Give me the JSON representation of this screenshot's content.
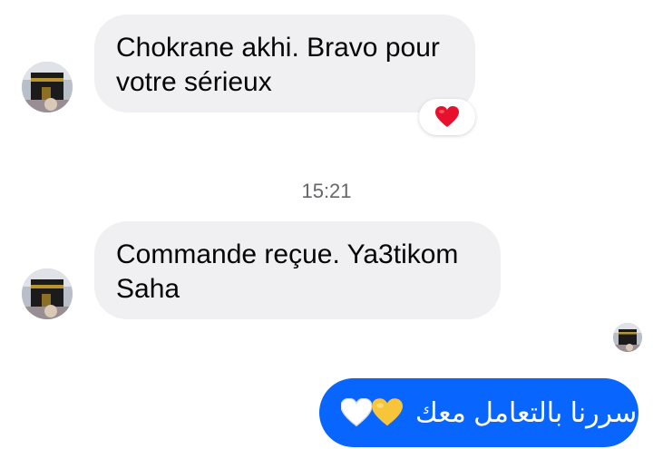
{
  "messages": [
    {
      "lines": [
        "Chokrane akhi. Bravo pour",
        "votre sérieux"
      ],
      "reaction": "red-heart"
    },
    {
      "lines": [
        "Commande reçue. Ya3tikom",
        "Saha"
      ]
    }
  ],
  "timestamp": "15:21",
  "outgoing": {
    "text": "سررنا بالتعامل معك",
    "emojis": [
      "white-heart",
      "yellow-heart"
    ]
  },
  "colors": {
    "incoming_bubble": "#f0f0f3",
    "outgoing_bubble": "#0866ff",
    "timestamp": "#65676b",
    "red_heart": "#e8112d",
    "yellow_heart": "#f7c43a"
  }
}
